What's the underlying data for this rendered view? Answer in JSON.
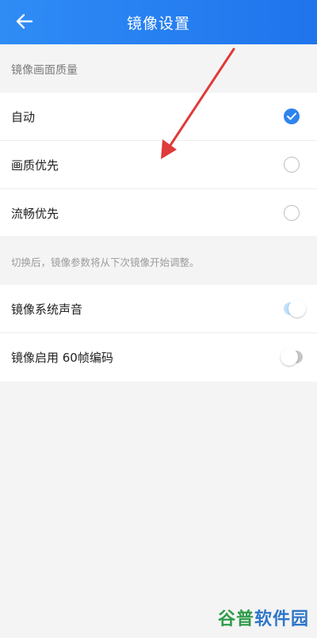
{
  "header": {
    "title": "镜像设置",
    "back_icon": "arrow-left-icon"
  },
  "quality": {
    "section_title": "镜像画面质量",
    "options": [
      {
        "label": "自动",
        "selected": true
      },
      {
        "label": "画质优先",
        "selected": false
      },
      {
        "label": "流畅优先",
        "selected": false
      }
    ],
    "hint": "切换后，镜像参数将从下次镜像开始调整。"
  },
  "settings": {
    "items": [
      {
        "label": "镜像系统声音",
        "toggle": "on"
      },
      {
        "label": "镜像启用 60帧编码",
        "toggle": "off"
      }
    ]
  },
  "colors": {
    "header": "#1f74ec",
    "accent": "#2f83ee",
    "annotation": "#e03a3a"
  },
  "watermark": {
    "part1": "谷普",
    "part2": "软件园"
  }
}
